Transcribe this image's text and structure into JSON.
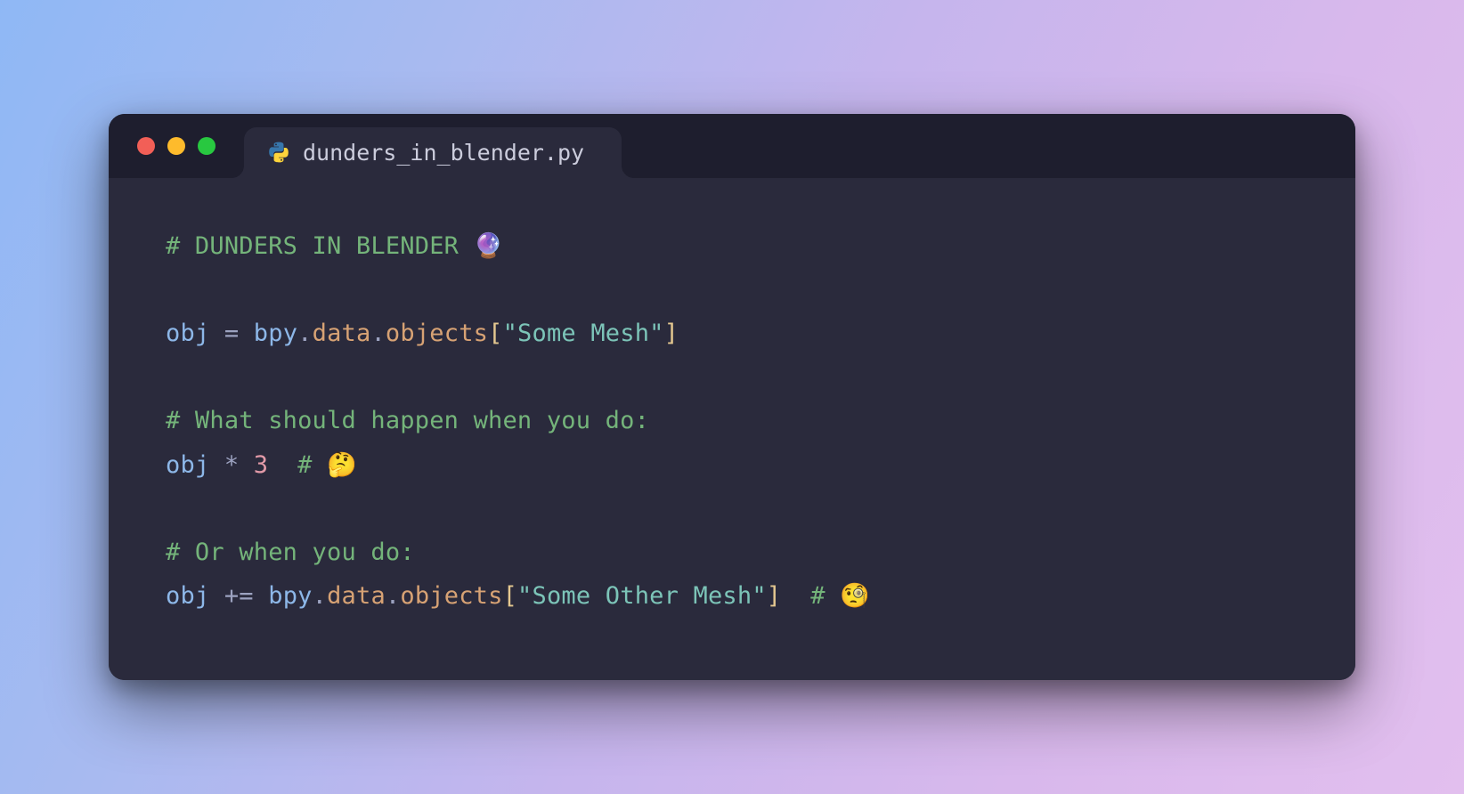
{
  "tab": {
    "filename": "dunders_in_blender.py",
    "language": "python"
  },
  "code": {
    "lines": [
      [
        {
          "cls": "c-comment",
          "text": "# DUNDERS IN BLENDER 🔮"
        }
      ],
      [],
      [
        {
          "cls": "c-ident",
          "text": "obj"
        },
        {
          "cls": "",
          "text": " "
        },
        {
          "cls": "c-op",
          "text": "="
        },
        {
          "cls": "",
          "text": " "
        },
        {
          "cls": "c-ident",
          "text": "bpy"
        },
        {
          "cls": "c-punct",
          "text": "."
        },
        {
          "cls": "c-member",
          "text": "data"
        },
        {
          "cls": "c-punct",
          "text": "."
        },
        {
          "cls": "c-member",
          "text": "objects"
        },
        {
          "cls": "c-bracket",
          "text": "["
        },
        {
          "cls": "c-string",
          "text": "\"Some Mesh\""
        },
        {
          "cls": "c-bracket",
          "text": "]"
        }
      ],
      [],
      [
        {
          "cls": "c-comment",
          "text": "# What should happen when you do:"
        }
      ],
      [
        {
          "cls": "c-ident",
          "text": "obj"
        },
        {
          "cls": "",
          "text": " "
        },
        {
          "cls": "c-op",
          "text": "*"
        },
        {
          "cls": "",
          "text": " "
        },
        {
          "cls": "c-number",
          "text": "3"
        },
        {
          "cls": "",
          "text": "  "
        },
        {
          "cls": "c-comment",
          "text": "# 🤔"
        }
      ],
      [],
      [
        {
          "cls": "c-comment",
          "text": "# Or when you do:"
        }
      ],
      [
        {
          "cls": "c-ident",
          "text": "obj"
        },
        {
          "cls": "",
          "text": " "
        },
        {
          "cls": "c-op",
          "text": "+="
        },
        {
          "cls": "",
          "text": " "
        },
        {
          "cls": "c-ident",
          "text": "bpy"
        },
        {
          "cls": "c-punct",
          "text": "."
        },
        {
          "cls": "c-member",
          "text": "data"
        },
        {
          "cls": "c-punct",
          "text": "."
        },
        {
          "cls": "c-member",
          "text": "objects"
        },
        {
          "cls": "c-bracket",
          "text": "["
        },
        {
          "cls": "c-string",
          "text": "\"Some Other Mesh\""
        },
        {
          "cls": "c-bracket",
          "text": "]"
        },
        {
          "cls": "",
          "text": "  "
        },
        {
          "cls": "c-comment",
          "text": "# 🧐"
        }
      ]
    ]
  },
  "colors": {
    "window_bg": "#1e1e2e",
    "editor_bg": "#2a2a3c",
    "comment": "#74b47a",
    "identifier": "#8db7e8",
    "member": "#d7a274",
    "string": "#7cc4b8",
    "bracket": "#e5c890",
    "number": "#e29aa8",
    "operator": "#9ca2c0"
  }
}
